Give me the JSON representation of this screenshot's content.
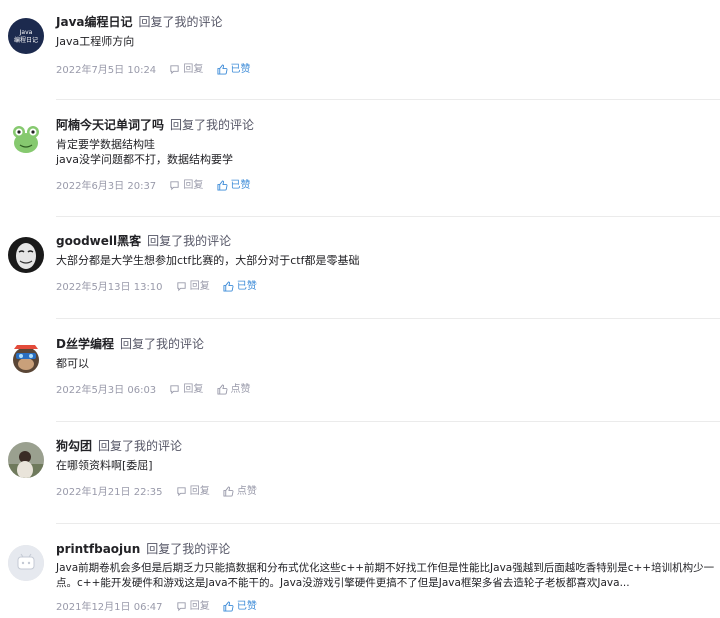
{
  "comments": [
    {
      "user": "Java编程日记",
      "action": "回复了我的评论",
      "lines": [
        "Java工程师方向"
      ],
      "time": "2022年7月5日 10:24",
      "reply": "回复",
      "like": "已赞",
      "liked": true,
      "avatar_text": "Java编程日记",
      "avatar_color": "#1c2a4e"
    },
    {
      "user": "阿楠今天记单词了吗",
      "action": "回复了我的评论",
      "lines": [
        "肯定要学数据结构哇",
        "java没学问题都不打，数据结构要学"
      ],
      "time": "2022年6月3日 20:37",
      "reply": "回复",
      "like": "已赞",
      "liked": true,
      "avatar_color": "#7cc46a"
    },
    {
      "user": "goodwell黑客",
      "action": "回复了我的评论",
      "lines": [
        "大部分都是大学生想参加ctf比赛的，大部分对于ctf都是零基础"
      ],
      "time": "2022年5月13日 13:10",
      "reply": "回复",
      "like": "已赞",
      "liked": true,
      "avatar_color": "#1a1a1a"
    },
    {
      "user": "D丝学编程",
      "action": "回复了我的评论",
      "lines": [
        "都可以"
      ],
      "time": "2022年5月3日 06:03",
      "reply": "回复",
      "like": "点赞",
      "liked": false,
      "avatar_color": "#3a6fb0"
    },
    {
      "user": "狗勾团",
      "action": "回复了我的评论",
      "lines": [
        "在哪领资料啊[委屈]"
      ],
      "time": "2022年1月21日 22:35",
      "reply": "回复",
      "like": "点赞",
      "liked": false,
      "avatar_color": "#8a8f7e"
    },
    {
      "user": "printfbaojun",
      "action": "回复了我的评论",
      "lines": [
        "Java前期卷机会多但是后期乏力只能搞数据和分布式优化这些c++前期不好找工作但是性能比Java强越到后面越吃香特别是c++培训机构少一点。c++能开发硬件和游戏这是Java不能干的。Java没游戏引擎硬件更搞不了但是Java框架多省去造轮子老板都喜欢Java..."
      ],
      "time": "2021年12月1日 06:47",
      "reply": "回复",
      "like": "已赞",
      "liked": true,
      "avatar_color": "#dfe3ea"
    }
  ],
  "colors": {
    "liked": "#3e8cd8",
    "meta": "#999aaa",
    "divider": "#ebebeb"
  }
}
